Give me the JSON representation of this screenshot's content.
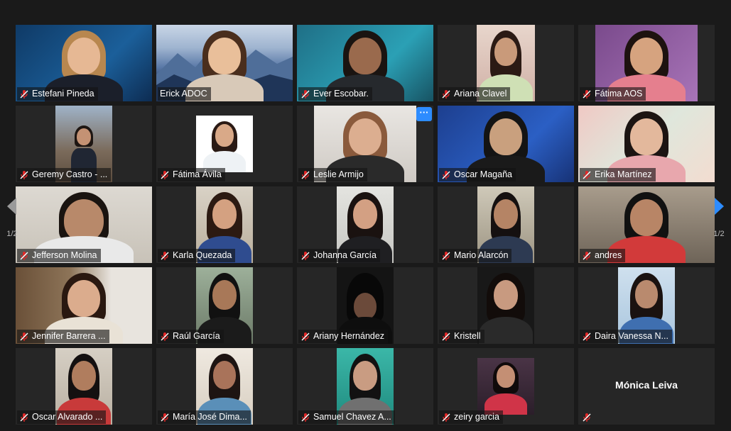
{
  "participants": [
    {
      "name": "Estefani Pineda"
    },
    {
      "name": "Erick ADOC"
    },
    {
      "name": "Ever Escobar."
    },
    {
      "name": "Ariana Clavel"
    },
    {
      "name": "Fátima AOS"
    },
    {
      "name": "Geremy Castro - ..."
    },
    {
      "name": "Fátima Ávila"
    },
    {
      "name": "Leslie Armijo"
    },
    {
      "name": "Oscar Magaña"
    },
    {
      "name": "Erika Martínez"
    },
    {
      "name": "Jefferson Molina"
    },
    {
      "name": "Karla Quezada"
    },
    {
      "name": "Johanna García"
    },
    {
      "name": "Mario Alarcón"
    },
    {
      "name": "andres"
    },
    {
      "name": "Jennifer Barrera ..."
    },
    {
      "name": "Raúl García"
    },
    {
      "name": "Ariany Hernández"
    },
    {
      "name": "Kristell"
    },
    {
      "name": "Daira Vanessa N..."
    },
    {
      "name": "Oscar Alvarado ..."
    },
    {
      "name": "María José Dima..."
    },
    {
      "name": "Samuel Chavez A..."
    },
    {
      "name": "zeiry garcia"
    },
    {
      "name": "Mónica Leiva"
    }
  ],
  "nav": {
    "prev_page_label": "1/2",
    "next_page_label": "1/2"
  },
  "more_button_label": "···",
  "colors": {
    "active_speaker_border": "#e3e07a",
    "accent": "#2d8cff",
    "muted_mic": "#e02828",
    "background": "#1a1a1a"
  }
}
